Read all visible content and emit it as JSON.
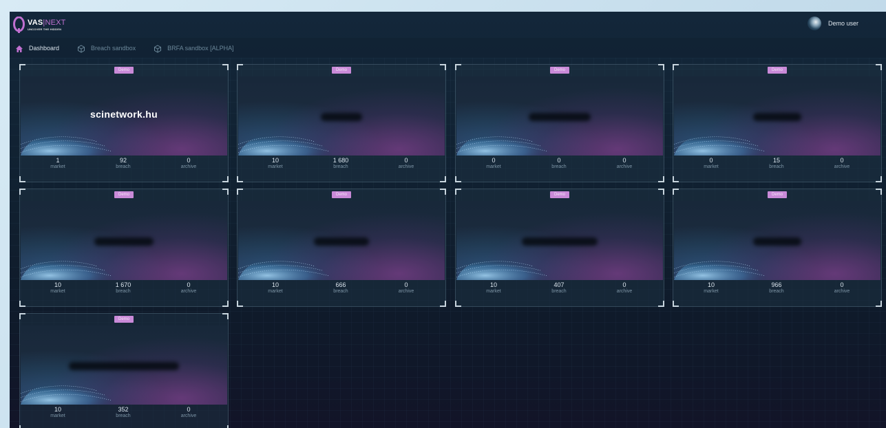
{
  "app": {
    "logo_main": "VAS",
    "logo_next": "NEXT",
    "logo_sub": "UNCOVER THE HIDDEN",
    "user_name": "Demo user"
  },
  "nav": [
    {
      "label": "Dashboard",
      "icon": "home-icon",
      "active": true
    },
    {
      "label": "Breach sandbox",
      "icon": "cube-icon",
      "active": false
    },
    {
      "label": "BRFA sandbox [ALPHA]",
      "icon": "cube-icon",
      "active": false
    }
  ],
  "stat_labels": {
    "market": "market",
    "breach": "breach",
    "archive": "archive"
  },
  "cards": [
    {
      "badge": "Demo",
      "domain": "scinetwork.hu",
      "blurred": false,
      "market": "1",
      "breach": "92",
      "archive": "0"
    },
    {
      "badge": "Demo",
      "domain": "",
      "blurred": true,
      "market": "10",
      "breach": "1 680",
      "archive": "0"
    },
    {
      "badge": "Demo",
      "domain": "",
      "blurred": true,
      "market": "0",
      "breach": "0",
      "archive": "0"
    },
    {
      "badge": "Demo",
      "domain": "",
      "blurred": true,
      "market": "0",
      "breach": "15",
      "archive": "0"
    },
    {
      "badge": "Demo",
      "domain": "",
      "blurred": true,
      "market": "10",
      "breach": "1 670",
      "archive": "0"
    },
    {
      "badge": "Demo",
      "domain": "",
      "blurred": true,
      "market": "10",
      "breach": "666",
      "archive": "0"
    },
    {
      "badge": "Demo",
      "domain": "",
      "blurred": true,
      "market": "10",
      "breach": "407",
      "archive": "0"
    },
    {
      "badge": "Demo",
      "domain": "",
      "blurred": true,
      "market": "10",
      "breach": "966",
      "archive": "0"
    },
    {
      "badge": "Demo",
      "domain": "",
      "blurred": true,
      "market": "10",
      "breach": "352",
      "archive": "0"
    }
  ]
}
